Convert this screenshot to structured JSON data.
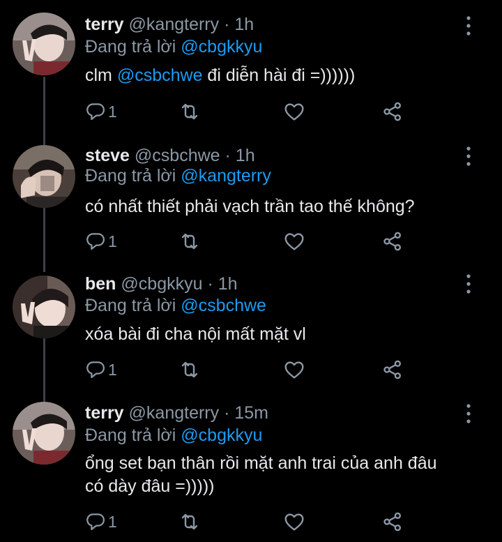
{
  "theme": {
    "background": "#000000",
    "text": "#e7e9ea",
    "muted": "#8b98a5",
    "accent": "#1d9bf0"
  },
  "tweets": [
    {
      "name": "terry",
      "handle": "@kangterry",
      "separator": "·",
      "time": "1h",
      "reply_prefix": "Đang trả lời ",
      "reply_to": "@cbgkkyu",
      "content_before": "clm ",
      "content_mention": "@csbchwe",
      "content_after": " đi diễn hài đi =))))))",
      "reply_count": "1",
      "icons": [
        "reply-icon",
        "retweet-icon",
        "like-icon",
        "share-icon",
        "more-icon"
      ]
    },
    {
      "name": "steve",
      "handle": "@csbchwe",
      "separator": "·",
      "time": "1h",
      "reply_prefix": "Đang trả lời ",
      "reply_to": "@kangterry",
      "content": "có nhất thiết phải vạch trần tao thế không?",
      "reply_count": "1",
      "icons": [
        "reply-icon",
        "retweet-icon",
        "like-icon",
        "share-icon",
        "more-icon"
      ]
    },
    {
      "name": "ben",
      "handle": "@cbgkkyu",
      "separator": "·",
      "time": "1h",
      "reply_prefix": "Đang trả lời ",
      "reply_to": "@csbchwe",
      "content": "xóa bài đi cha nội mất mặt vl",
      "reply_count": "1",
      "icons": [
        "reply-icon",
        "retweet-icon",
        "like-icon",
        "share-icon",
        "more-icon"
      ]
    },
    {
      "name": "terry",
      "handle": "@kangterry",
      "separator": "·",
      "time": "15m",
      "reply_prefix": "Đang trả lời ",
      "reply_to": "@cbgkkyu",
      "content_line1": "ổng set bạn thân rồi mặt anh trai của anh đâu",
      "content_line2": "có dày đâu =)))))",
      "reply_count": "1",
      "icons": [
        "reply-icon",
        "retweet-icon",
        "like-icon",
        "share-icon",
        "more-icon"
      ]
    }
  ]
}
